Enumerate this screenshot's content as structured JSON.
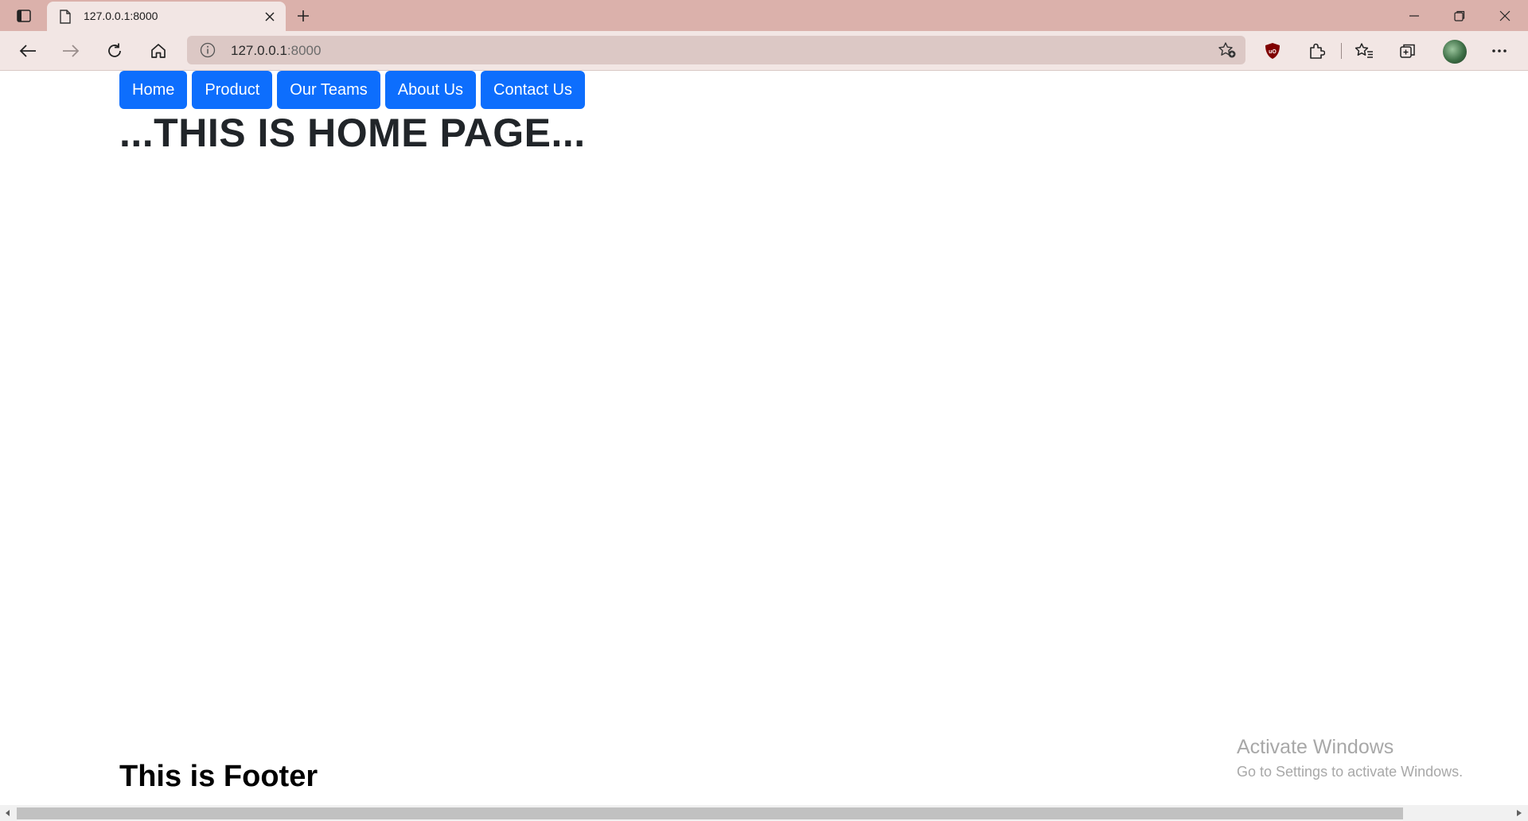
{
  "browser": {
    "tab": {
      "title": "127.0.0.1:8000"
    },
    "address": {
      "host": "127.0.0.1",
      "port": ":8000"
    }
  },
  "page": {
    "nav": [
      {
        "label": "Home"
      },
      {
        "label": "Product"
      },
      {
        "label": "Our Teams"
      },
      {
        "label": "About Us"
      },
      {
        "label": "Contact Us"
      }
    ],
    "heading": "...THIS IS HOME PAGE...",
    "footer": "This is Footer"
  },
  "watermark": {
    "title": "Activate Windows",
    "subtitle": "Go to Settings to activate Windows."
  },
  "colors": {
    "tabstrip": "#dbb1ab",
    "toolbar": "#f2e6e4",
    "nav_button": "#0d6efd",
    "heading_text": "#212529"
  }
}
